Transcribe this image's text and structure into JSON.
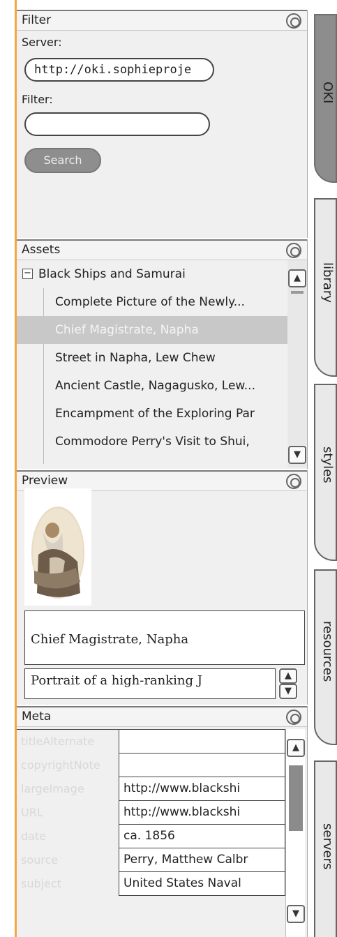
{
  "filter_panel": {
    "title": "Filter",
    "server_label": "Server:",
    "server_value": "http://oki.sophieproje",
    "filter_label": "Filter:",
    "filter_value": "",
    "search_label": "Search"
  },
  "assets_panel": {
    "title": "Assets",
    "root": "Black Ships and Samurai",
    "items": [
      "Complete Picture of the Newly...",
      "Chief Magistrate, Napha",
      "Street in Napha, Lew Chew",
      "Ancient Castle, Nagagusko, Lew...",
      "Encampment of the Exploring Par",
      "Commodore Perry's Visit to Shui,"
    ],
    "selected_index": 1
  },
  "preview_panel": {
    "title": "Preview",
    "caption": "Chief Magistrate, Napha",
    "description": "Portrait of a high-ranking J"
  },
  "meta_panel": {
    "title": "Meta",
    "rows": [
      {
        "key": "titleAlternate",
        "value": ""
      },
      {
        "key": "copyrightNote",
        "value": ""
      },
      {
        "key": "largeImage",
        "value": "http://www.blackshi"
      },
      {
        "key": "URL",
        "value": "http://www.blackshi"
      },
      {
        "key": "date",
        "value": "ca. 1856"
      },
      {
        "key": "source",
        "value": "Perry, Matthew Calbr"
      },
      {
        "key": "subject",
        "value": "United States Naval"
      }
    ]
  },
  "side_tabs": [
    "OKI",
    "library",
    "styles",
    "resources",
    "servers"
  ]
}
